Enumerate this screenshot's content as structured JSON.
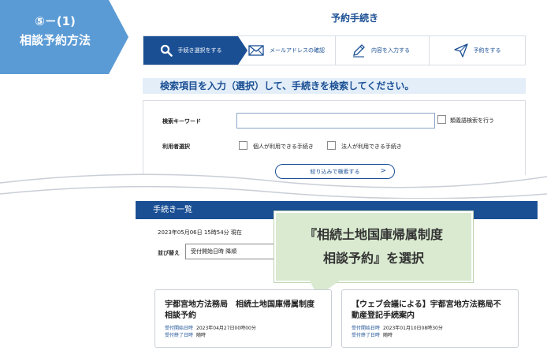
{
  "badge": {
    "number": "⑤－(1)",
    "title": "相談予約方法",
    "color": "#5b9bd5"
  },
  "header": {
    "title": "予約手続き"
  },
  "stepper": {
    "steps": [
      {
        "label": "手続き選択をする",
        "icon": "search-icon",
        "active": true
      },
      {
        "label": "メールアドレスの確認",
        "icon": "envelope-icon",
        "active": false
      },
      {
        "label": "内容を入力する",
        "icon": "pencil-icon",
        "active": false
      },
      {
        "label": "予約をする",
        "icon": "send-icon",
        "active": false
      }
    ]
  },
  "search": {
    "heading": "検索項目を入力（選択）して、手続きを検索してください。",
    "keyword_label": "検索キーワード",
    "keyword_value": "",
    "synonym_checkbox_label": "類義語検索を行う",
    "user_label": "利用者選択",
    "individual_label": "個人が利用できる手続き",
    "corporate_label": "法人が利用できる手続き",
    "narrow_button_label": "絞り込みで検索する",
    "narrow_button_arrow": ">"
  },
  "list": {
    "heading": "手続き一覧",
    "timestamp": "2023年05月06日 15時54分 現在",
    "sort_label": "並び替え",
    "sort_value": "受付開始日時 降順"
  },
  "callout": {
    "line1": "『相続土地国庫帰属制度",
    "line2": "相談予約』を選択"
  },
  "cards": [
    {
      "title": "宇都宮地方法務局　相続土地国庫帰属制度　相談予約",
      "start_key": "受付開始日時",
      "start_value": "2023年04月27日00時00分",
      "end_key": "受付終了日時",
      "end_value": "随時"
    },
    {
      "title": "【ウェブ会議による】宇都宮地方法務局不動産登記手続案内",
      "start_key": "受付開始日時",
      "start_value": "2023年01月10日08時30分",
      "end_key": "受付終了日時",
      "end_value": "随時"
    }
  ]
}
